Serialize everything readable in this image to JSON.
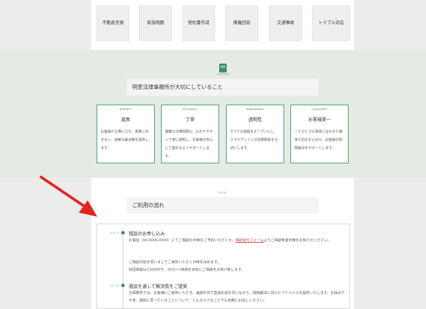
{
  "services": [
    "不動産売買",
    "家族問題",
    "契約書作成",
    "債権回収",
    "交通事故",
    "トラブル対応"
  ],
  "feature": {
    "eyebrow": "FEATURE",
    "title": "明里法律事務所が大切にしていること",
    "cards": [
      {
        "en": "INTEGRITY",
        "jp": "誠実",
        "body": "お客様の立場に立ち、真摯に向き合い、誠実な解決策を提供します。"
      },
      {
        "en": "POLITENESS",
        "jp": "丁寧",
        "body": "複雑な法律問題も、わかりやすく丁寧に説明し、お客様が安心して進めるようサポートします。"
      },
      {
        "en": "TRANSPARENCY",
        "jp": "透明性",
        "body": "すべての過程をオープンにし、クライアントとの信頼関係を大切にします。"
      },
      {
        "en": "CLIENT-FIRST",
        "jp": "お客様第一",
        "body": "一人ひとりの事情に合わせた親身な対応を心がけ、お客様の問題解決をサポートします。"
      }
    ]
  },
  "flow": {
    "eyebrow": "FLOW",
    "title": "ご利用の流れ",
    "steps": [
      {
        "label": "ステップ",
        "title": "相談のお申し込み",
        "line1_a": "お電話（00-0000-0000）にてご相談の日時をご予約いただくか、",
        "line1_link": "相談受付フォーム",
        "line1_b": "よりご相談希望日時をお知らせください。",
        "line2": "ご相談内容を伺いましてご来所いただく日時を決めます。",
        "line3": "初回相談は3,000円で、30分〜1時間を目安にご相談をお受け致します。"
      },
      {
        "label": "ステップ",
        "title": "面談を通して解決策をご提案",
        "line1": "当事務所では、お客様にご来所いただき、面談形式で直接お話を伺いながら、問題解決に向けたアドバイスを提供いたします。お悩みや不安、疑問に思っていることについて、どんな小さなことでも気軽にお話しください。"
      }
    ]
  }
}
